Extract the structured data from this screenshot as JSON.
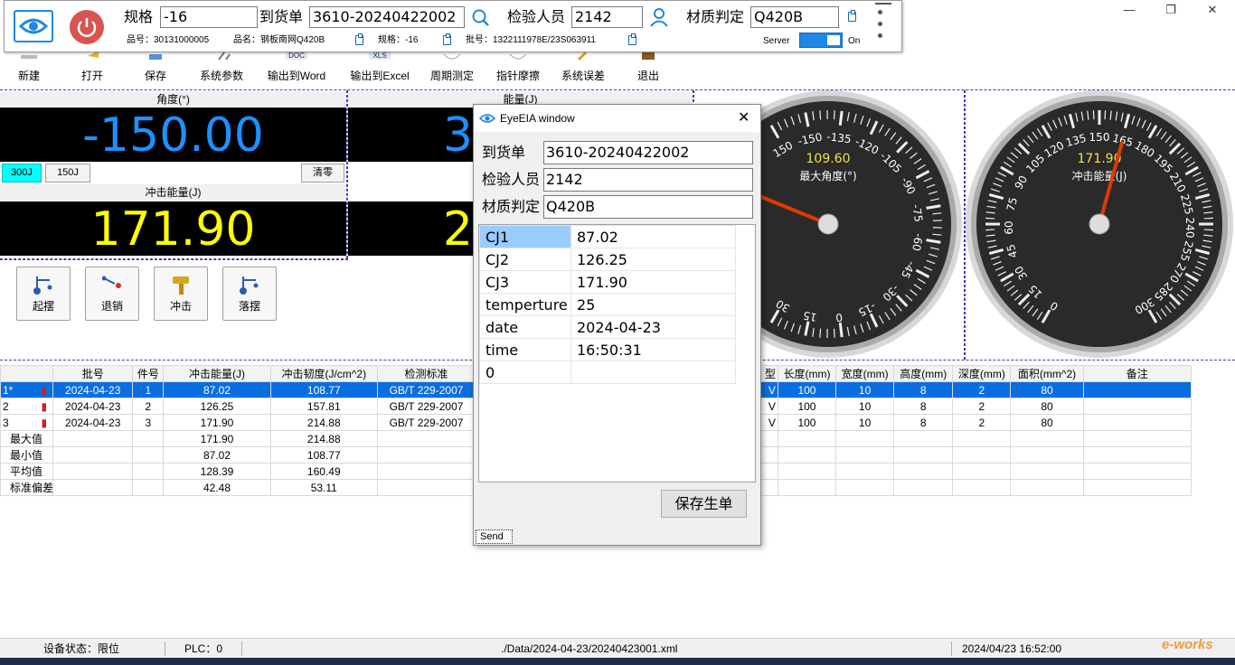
{
  "top": {
    "spec_label": "规格",
    "spec_value": "-16",
    "order_label": "到货单",
    "order_value": "3610-20240422002",
    "inspector_label": "检验人员",
    "inspector_value": "2142",
    "material_label": "材质判定",
    "material_value": "Q420B",
    "info_partno": "品号：30131000005",
    "info_name": "品名：钢板南网Q420B",
    "info_spec": "规格：-16",
    "info_batch": "批号：1322111978E/23S063911",
    "server_label": "Server",
    "server_state": "On"
  },
  "toolbar": [
    {
      "label": "新建",
      "icon": "new-icon"
    },
    {
      "label": "打开",
      "icon": "open-icon"
    },
    {
      "label": "保存",
      "icon": "save-icon"
    },
    {
      "label": "系统参数",
      "icon": "settings-icon"
    },
    {
      "label": "输出到Word",
      "icon": "word-doc-icon",
      "badge": "DOC"
    },
    {
      "label": "输出到Excel",
      "icon": "excel-xls-icon",
      "badge": "XLS"
    },
    {
      "label": "周期测定",
      "icon": "period-icon"
    },
    {
      "label": "指针摩擦",
      "icon": "pointer-friction-icon"
    },
    {
      "label": "系统误差",
      "icon": "system-error-icon"
    },
    {
      "label": "退出",
      "icon": "exit-icon"
    }
  ],
  "displays": {
    "angle_header": "角度(°)",
    "angle_value": "-150.00",
    "energy_header": "能量(J)",
    "energy_value_partial": "3",
    "impact_header": "冲击能量(J)",
    "impact_value": "171.90",
    "impact_right_partial": "2",
    "btn_300j": "300J",
    "btn_150j": "150J",
    "btn_clear": "清零"
  },
  "actions": [
    "起摆",
    "退销",
    "冲击",
    "落摆"
  ],
  "gauges": [
    {
      "value": "109.60",
      "label": "最大角度(°)",
      "accent": "#f4e04d"
    },
    {
      "value": "171.90",
      "label": "冲击能量(J)",
      "accent": "#f4e04d"
    }
  ],
  "gauge_left_scale": [
    "150",
    "-150",
    "-135",
    "-120",
    "-105",
    "-90",
    "-75",
    "-60",
    "-45",
    "-30",
    "-15",
    "0",
    "15",
    "30"
  ],
  "gauge_right_scale": [
    "0",
    "15",
    "30",
    "45",
    "60",
    "75",
    "90",
    "105",
    "120",
    "135",
    "150",
    "165",
    "180",
    "195",
    "210",
    "225",
    "240",
    "255",
    "270",
    "285",
    "300"
  ],
  "grid": {
    "headers_left": [
      "批号",
      "件号",
      "冲击能量(J)",
      "冲击韧度(J/cm^2)",
      "检测标准"
    ],
    "headers_right": [
      "型",
      "长度(mm)",
      "宽度(mm)",
      "高度(mm)",
      "深度(mm)",
      "面积(mm^2)",
      "备注"
    ],
    "rows": [
      {
        "rh": "1*",
        "batch": "2024-04-23",
        "no": "1",
        "energy": "87.02",
        "tough": "108.77",
        "std": "GB/T 229-2007",
        "type": "V",
        "len": "100",
        "wid": "10",
        "hei": "8",
        "dep": "2",
        "area": "80",
        "sel": true
      },
      {
        "rh": "2",
        "batch": "2024-04-23",
        "no": "2",
        "energy": "126.25",
        "tough": "157.81",
        "std": "GB/T 229-2007",
        "type": "V",
        "len": "100",
        "wid": "10",
        "hei": "8",
        "dep": "2",
        "area": "80",
        "sel": false
      },
      {
        "rh": "3",
        "batch": "2024-04-23",
        "no": "3",
        "energy": "171.90",
        "tough": "214.88",
        "std": "GB/T 229-2007",
        "type": "V",
        "len": "100",
        "wid": "10",
        "hei": "8",
        "dep": "2",
        "area": "80",
        "sel": false
      }
    ],
    "stats": [
      {
        "label": "最大值",
        "energy": "171.90",
        "tough": "214.88"
      },
      {
        "label": "最小值",
        "energy": "87.02",
        "tough": "108.77"
      },
      {
        "label": "平均值",
        "energy": "128.39",
        "tough": "160.49"
      },
      {
        "label": "标准偏差",
        "energy": "42.48",
        "tough": "53.11"
      }
    ]
  },
  "dialog": {
    "title": "EyeEIA window",
    "order_label": "到货单",
    "order_value": "3610-20240422002",
    "inspector_label": "检验人员",
    "inspector_value": "2142",
    "material_label": "材质判定",
    "material_value": "Q420B",
    "rows": [
      {
        "k": "CJ1",
        "v": "87.02"
      },
      {
        "k": "CJ2",
        "v": "126.25"
      },
      {
        "k": "CJ3",
        "v": "171.90"
      },
      {
        "k": "temperture",
        "v": "25"
      },
      {
        "k": "date",
        "v": "2024-04-23"
      },
      {
        "k": "time",
        "v": "16:50:31"
      },
      {
        "k": "0",
        "v": ""
      }
    ],
    "save_button": "保存生单",
    "send_tab": "Send"
  },
  "status": {
    "device": "设备状态：限位",
    "plc": "PLC：0",
    "file": "./Data/2024-04-23/20240423001.xml",
    "datetime": "2024/04/23  16:52:00",
    "watermark": "e-works"
  },
  "colors": {
    "accent_blue": "#0a6ee0",
    "display_blue": "#1e90ff",
    "display_yellow": "#ffff00",
    "btn_300j": "#00ffff"
  }
}
